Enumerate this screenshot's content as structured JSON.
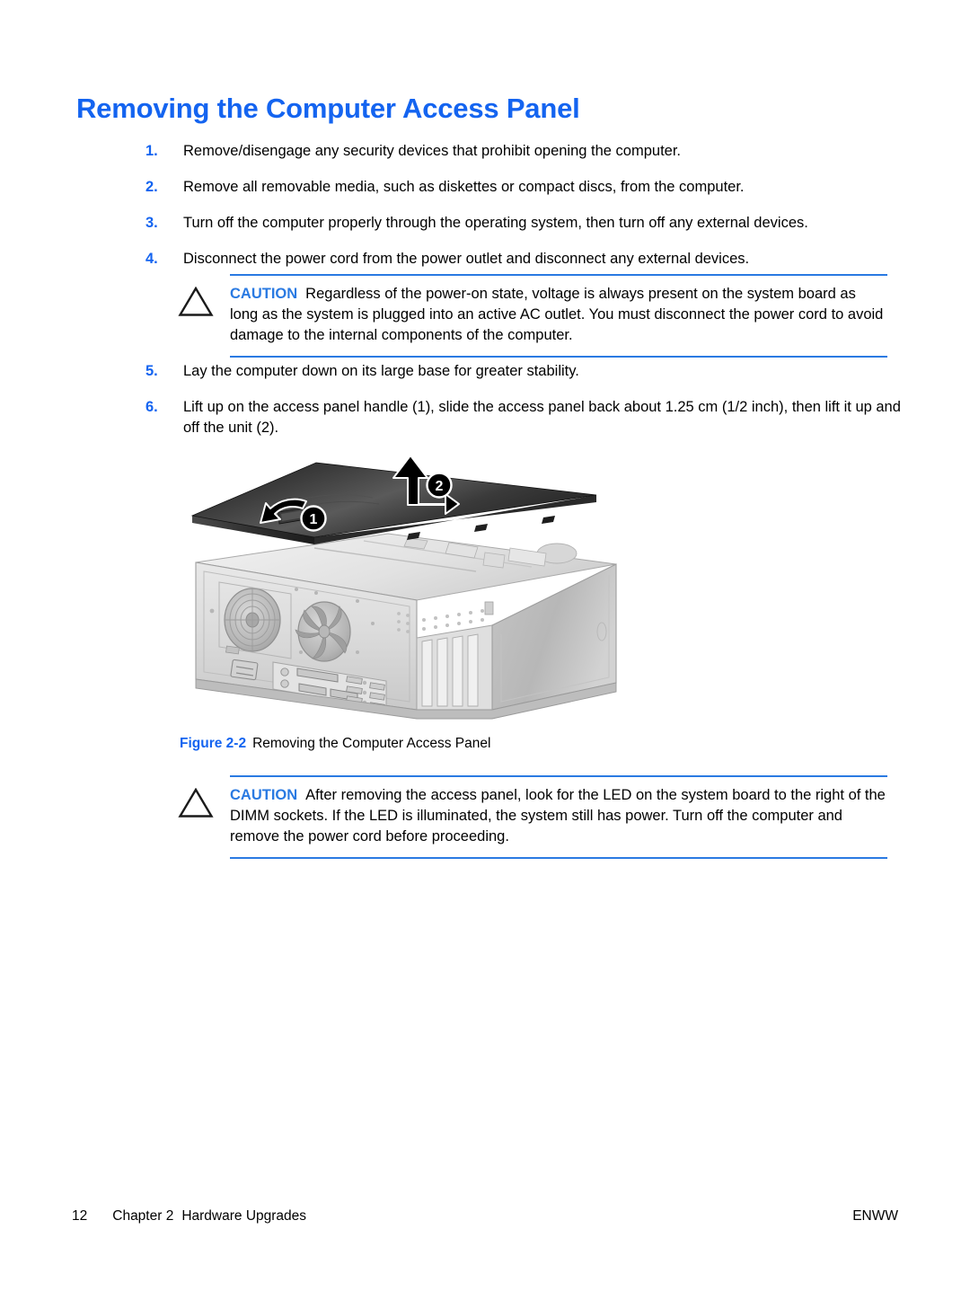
{
  "document": {
    "heading": "Removing the Computer Access Panel",
    "accent_blue": "#1464f0",
    "rule_blue": "#2a7ae2",
    "page_background": "#ffffff"
  },
  "steps_part1": [
    {
      "num": "1.",
      "text": "Remove/disengage any security devices that prohibit opening the computer."
    },
    {
      "num": "2.",
      "text": "Remove all removable media, such as diskettes or compact discs, from the computer."
    },
    {
      "num": "3.",
      "text": "Turn off the computer properly through the operating system, then turn off any external devices."
    },
    {
      "num": "4.",
      "text": "Disconnect the power cord from the power outlet and disconnect any external devices."
    }
  ],
  "caution_1": {
    "icon": "caution-triangle-icon",
    "label": "CAUTION",
    "text": "Regardless of the power-on state, voltage is always present on the system board as long as the system is plugged into an active AC outlet. You must disconnect the power cord to avoid damage to the internal components of the computer."
  },
  "steps_part2": [
    {
      "num": "5.",
      "text": "Lay the computer down on its large base for greater stability."
    },
    {
      "num": "6.",
      "text": "Lift up on the access panel handle (1), slide the access panel back about 1.25 cm (1/2 inch), then lift it up and off the unit (2)."
    }
  ],
  "figure": {
    "alt": "Exploded illustration of a desktop computer lying on its side with the access panel lifted off",
    "callouts": [
      {
        "id": "1",
        "meaning": "access panel handle"
      },
      {
        "id": "2",
        "meaning": "lift panel up and off the unit"
      }
    ],
    "caption_label": "Figure 2-2",
    "caption_text": "Removing the Computer Access Panel"
  },
  "caution_2": {
    "icon": "caution-triangle-icon",
    "label": "CAUTION",
    "text": "After removing the access panel, look for the LED on the system board to the right of the DIMM sockets. If the LED is illuminated, the system still has power. Turn off the computer and remove the power cord before proceeding."
  },
  "footer": {
    "page_number": "12",
    "chapter": "Chapter 2",
    "chapter_title": "Hardware Upgrades",
    "edition": "ENWW"
  }
}
